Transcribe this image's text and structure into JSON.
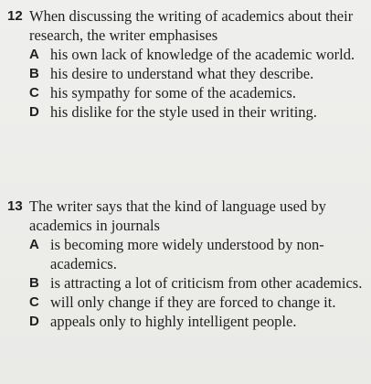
{
  "questions": [
    {
      "number": "12",
      "stem": "When discussing the writing of academics about their research, the writer emphasises",
      "options": [
        {
          "letter": "A",
          "text": "his own lack of knowledge of the academic world."
        },
        {
          "letter": "B",
          "text": "his desire to understand what they describe."
        },
        {
          "letter": "C",
          "text": "his sympathy for some of the academics."
        },
        {
          "letter": "D",
          "text": "his dislike for the style used in their writing."
        }
      ]
    },
    {
      "number": "13",
      "stem": "The writer says that the kind of language used by academics in journals",
      "options": [
        {
          "letter": "A",
          "text": "is becoming more widely understood by non-academics."
        },
        {
          "letter": "B",
          "text": "is attracting a lot of criticism from other academics."
        },
        {
          "letter": "C",
          "text": "will only change if they are forced to change it."
        },
        {
          "letter": "D",
          "text": "appeals only to highly intelligent people."
        }
      ]
    }
  ]
}
